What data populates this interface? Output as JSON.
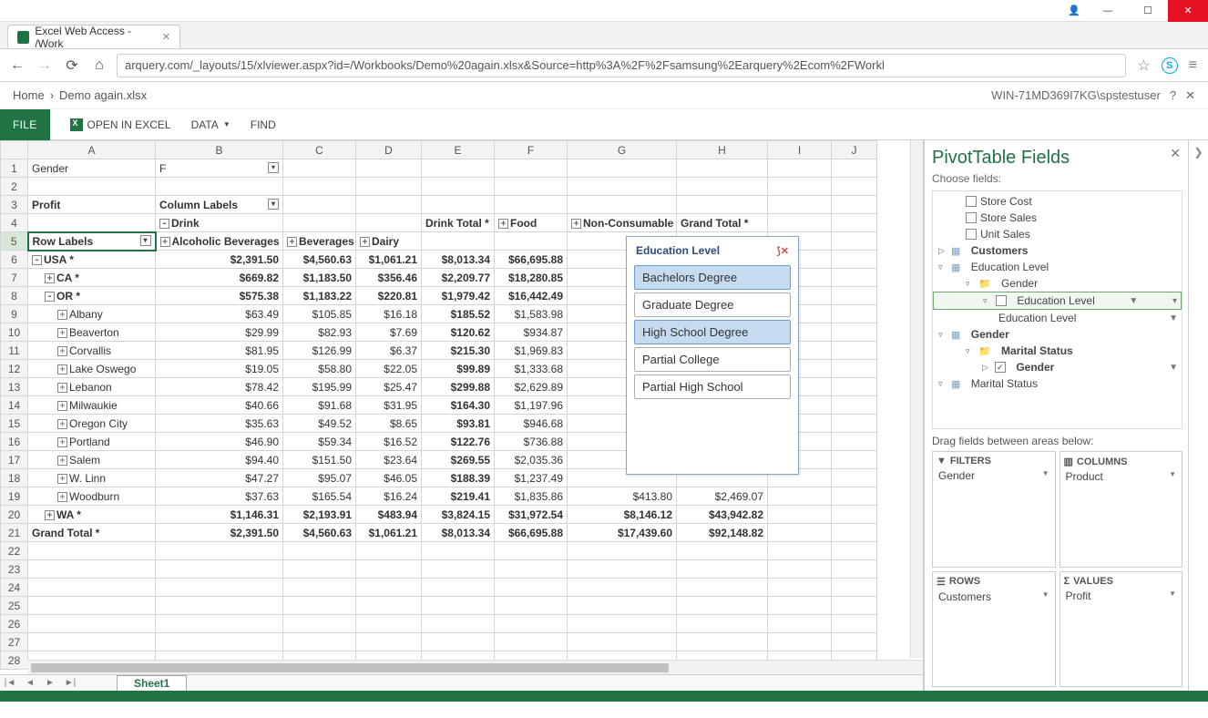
{
  "browser": {
    "tab_title": "Excel Web Access - /Work",
    "url": "arquery.com/_layouts/15/xlviewer.aspx?id=/Workbooks/Demo%20again.xlsx&Source=http%3A%2F%2Fsamsung%2Earquery%2Ecom%2FWorkl"
  },
  "breadcrumb": {
    "home": "Home",
    "file": "Demo again.xlsx",
    "user": "WIN-71MD369I7KG\\spstestuser"
  },
  "toolbar": {
    "file": "FILE",
    "open_in_excel": "OPEN IN EXCEL",
    "data": "DATA",
    "find": "FIND"
  },
  "columns": [
    "A",
    "B",
    "C",
    "D",
    "E",
    "F",
    "G",
    "H",
    "I",
    "J"
  ],
  "pivot": {
    "gender_label": "Gender",
    "gender_value": "F",
    "profit_label": "Profit",
    "column_labels": "Column Labels",
    "drink": "Drink",
    "alc_label": "Alcoholic Beverages",
    "bev_label": "Beverages",
    "dairy_label": "Dairy",
    "drink_total": "Drink Total *",
    "food": "Food",
    "noncons": "Non-Consumable",
    "grand_total_h": "Grand Total *",
    "row_labels": "Row Labels"
  },
  "rows": [
    {
      "n": 6,
      "l": "USA *",
      "alc": "$2,391.50",
      "bev": "$4,560.63",
      "dai": "$1,061.21",
      "dt": "$8,013.34",
      "food": "$66,695.88",
      "nc": "",
      "gt": "",
      "indent": 0,
      "exp": "-",
      "bold": true
    },
    {
      "n": 7,
      "l": "CA *",
      "alc": "$669.82",
      "bev": "$1,183.50",
      "dai": "$356.46",
      "dt": "$2,209.77",
      "food": "$18,280.85",
      "nc": "",
      "gt": "",
      "indent": 1,
      "exp": "+",
      "bold": true
    },
    {
      "n": 8,
      "l": "OR *",
      "alc": "$575.38",
      "bev": "$1,183.22",
      "dai": "$220.81",
      "dt": "$1,979.42",
      "food": "$16,442.49",
      "nc": "",
      "gt": "",
      "indent": 1,
      "exp": "-",
      "bold": true
    },
    {
      "n": 9,
      "l": "Albany",
      "alc": "$63.49",
      "bev": "$105.85",
      "dai": "$16.18",
      "dt": "$185.52",
      "food": "$1,583.98",
      "nc": "",
      "gt": "",
      "indent": 2,
      "exp": "+"
    },
    {
      "n": 10,
      "l": "Beaverton",
      "alc": "$29.99",
      "bev": "$82.93",
      "dai": "$7.69",
      "dt": "$120.62",
      "food": "$934.87",
      "nc": "",
      "gt": "",
      "indent": 2,
      "exp": "+"
    },
    {
      "n": 11,
      "l": "Corvallis",
      "alc": "$81.95",
      "bev": "$126.99",
      "dai": "$6.37",
      "dt": "$215.30",
      "food": "$1,969.83",
      "nc": "",
      "gt": "",
      "indent": 2,
      "exp": "+"
    },
    {
      "n": 12,
      "l": "Lake Oswego",
      "alc": "$19.05",
      "bev": "$58.80",
      "dai": "$22.05",
      "dt": "$99.89",
      "food": "$1,333.68",
      "nc": "",
      "gt": "",
      "indent": 2,
      "exp": "+"
    },
    {
      "n": 13,
      "l": "Lebanon",
      "alc": "$78.42",
      "bev": "$195.99",
      "dai": "$25.47",
      "dt": "$299.88",
      "food": "$2,629.89",
      "nc": "",
      "gt": "",
      "indent": 2,
      "exp": "+"
    },
    {
      "n": 14,
      "l": "Milwaukie",
      "alc": "$40.66",
      "bev": "$91.68",
      "dai": "$31.95",
      "dt": "$164.30",
      "food": "$1,197.96",
      "nc": "",
      "gt": "",
      "indent": 2,
      "exp": "+"
    },
    {
      "n": 15,
      "l": "Oregon City",
      "alc": "$35.63",
      "bev": "$49.52",
      "dai": "$8.65",
      "dt": "$93.81",
      "food": "$946.68",
      "nc": "",
      "gt": "",
      "indent": 2,
      "exp": "+"
    },
    {
      "n": 16,
      "l": "Portland",
      "alc": "$46.90",
      "bev": "$59.34",
      "dai": "$16.52",
      "dt": "$122.76",
      "food": "$736.88",
      "nc": "",
      "gt": "",
      "indent": 2,
      "exp": "+"
    },
    {
      "n": 17,
      "l": "Salem",
      "alc": "$94.40",
      "bev": "$151.50",
      "dai": "$23.64",
      "dt": "$269.55",
      "food": "$2,035.36",
      "nc": "",
      "gt": "",
      "indent": 2,
      "exp": "+"
    },
    {
      "n": 18,
      "l": "W. Linn",
      "alc": "$47.27",
      "bev": "$95.07",
      "dai": "$46.05",
      "dt": "$188.39",
      "food": "$1,237.49",
      "nc": "",
      "gt": "",
      "indent": 2,
      "exp": "+"
    },
    {
      "n": 19,
      "l": "Woodburn",
      "alc": "$37.63",
      "bev": "$165.54",
      "dai": "$16.24",
      "dt": "$219.41",
      "food": "$1,835.86",
      "nc": "$413.80",
      "gt": "$2,469.07",
      "indent": 2,
      "exp": "+"
    },
    {
      "n": 20,
      "l": "WA *",
      "alc": "$1,146.31",
      "bev": "$2,193.91",
      "dai": "$483.94",
      "dt": "$3,824.15",
      "food": "$31,972.54",
      "nc": "$8,146.12",
      "gt": "$43,942.82",
      "indent": 1,
      "exp": "+",
      "bold": true
    }
  ],
  "grand_total_row": {
    "l": "Grand Total *",
    "alc": "$2,391.50",
    "bev": "$4,560.63",
    "dai": "$1,061.21",
    "dt": "$8,013.34",
    "food": "$66,695.88",
    "nc": "$17,439.60",
    "gt": "$92,148.82"
  },
  "slicer": {
    "title": "Education Level",
    "items": [
      {
        "label": "Bachelors Degree",
        "sel": true
      },
      {
        "label": "Graduate Degree",
        "sel": false
      },
      {
        "label": "High School Degree",
        "sel": true
      },
      {
        "label": "Partial College",
        "sel": false
      },
      {
        "label": "Partial High School",
        "sel": false
      }
    ]
  },
  "fields_pane": {
    "title": "PivotTable Fields",
    "choose": "Choose fields:",
    "store_cost": "Store Cost",
    "store_sales": "Store Sales",
    "unit_sales": "Unit Sales",
    "customers": "Customers",
    "edu": "Education Level",
    "gender_dim": "Gender",
    "edu_level": "Education Level",
    "edu_leaf": "Education Level",
    "gender": "Gender",
    "marital_status": "Marital Status",
    "gender_leaf": "Gender",
    "marital_dim": "Marital Status",
    "drag": "Drag fields between areas below:",
    "filters": "FILTERS",
    "filters_item": "Gender",
    "columns": "COLUMNS",
    "columns_item": "Product",
    "rows": "ROWS",
    "rows_item": "Customers",
    "values": "VALUES",
    "values_item": "Profit"
  },
  "sheet_tab": "Sheet1"
}
